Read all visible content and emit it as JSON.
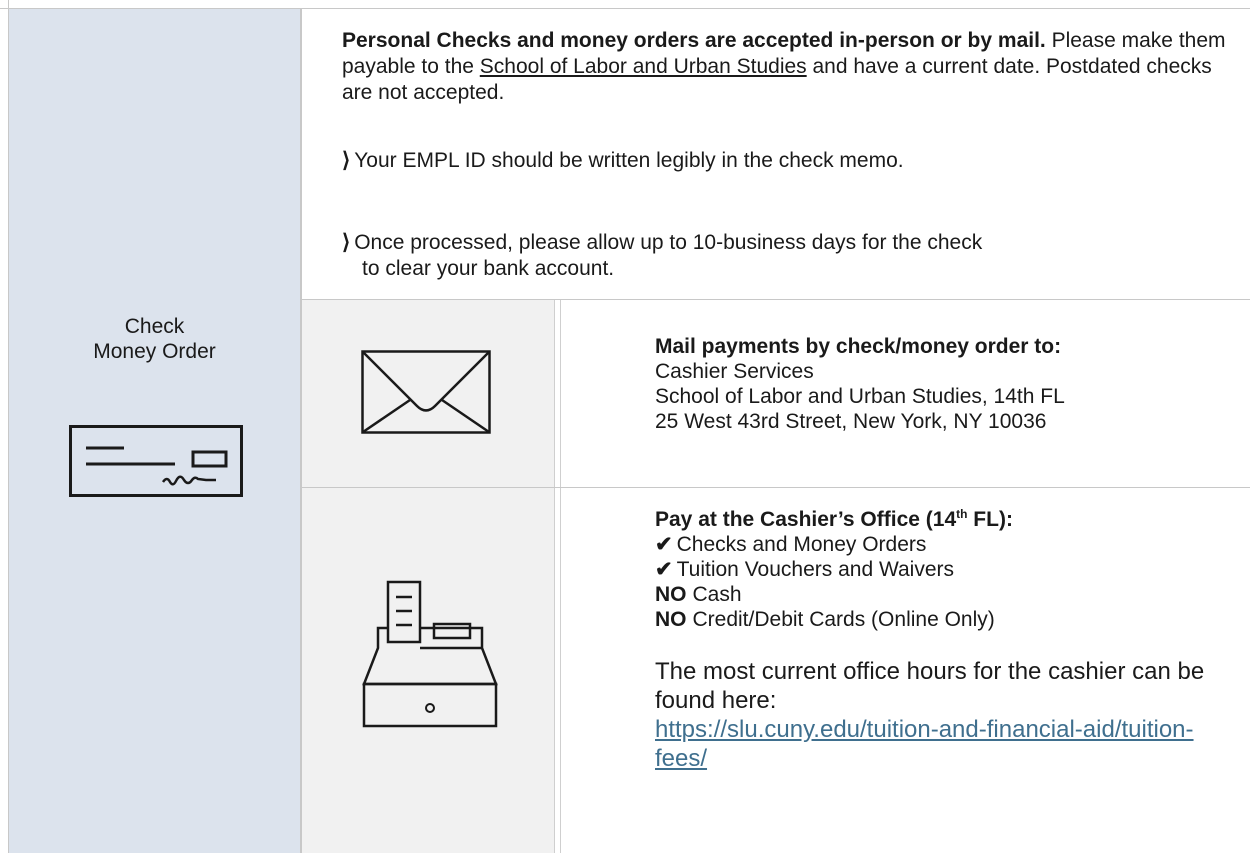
{
  "method": {
    "title_line1": "Check",
    "title_line2": "Money Order",
    "icon": "check-icon"
  },
  "intro": {
    "bold_text": "Personal Checks and money orders are accepted in-person or by mail.",
    "text_before_payee": " Please make them payable to the ",
    "payee": "School of Labor and Urban Studies",
    "text_after_payee": " and have a current date. Postdated checks are not accepted."
  },
  "bullets": [
    {
      "marker": "⟩",
      "text": "Your EMPL ID should be written legibly in the check memo."
    },
    {
      "marker": "⟩",
      "text_line1": "Once processed, please allow up to 10-business days for the check",
      "text_line2": "to clear your bank account."
    }
  ],
  "mail": {
    "icon": "envelope-icon",
    "heading": "Mail payments by check/money order to:",
    "address": [
      "Cashier Services",
      "School of Labor and Urban Studies, 14th FL",
      "25 West 43rd Street, New York, NY 10036"
    ]
  },
  "cashier": {
    "icon": "cash-register-icon",
    "heading_prefix": "Pay at the Cashier’s Office (14",
    "heading_sup": "th",
    "heading_suffix": " FL):",
    "accepted": [
      {
        "mark": "✔",
        "text": "Checks and Money Orders"
      },
      {
        "mark": "✔",
        "text": "Tuition Vouchers and Waivers"
      }
    ],
    "not_accepted": [
      {
        "mark": "NO",
        "text": "Cash"
      },
      {
        "mark": "NO",
        "text": "Credit/Debit Cards (Online Only)"
      }
    ],
    "hours_text": "The most current office hours for the cashier can be found here:",
    "link_text": "https://slu.cuny.edu/tuition-and-financial-aid/tuition-fees/"
  },
  "colors": {
    "left_column_bg": "#dce3ed",
    "icon_column_bg": "#f1f1f1",
    "link": "#3f6f8e"
  }
}
